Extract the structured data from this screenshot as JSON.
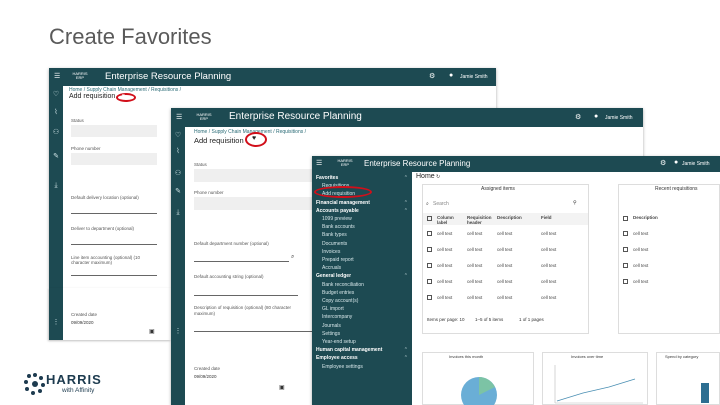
{
  "slide": {
    "title": "Create Favorites"
  },
  "app": {
    "name": "Enterprise Resource Planning",
    "user": "Jamie Smith",
    "logo_top": "HARRIS",
    "logo_bottom": "ERP"
  },
  "w1": {
    "breadcrumb": "Home / Supply Chain Management / Requisitions /",
    "page_title": "Add requisition",
    "fields": [
      "Status",
      "Phone number",
      "Default delivery location (optional)",
      "Deliver to department (optional)",
      "Line item accounting (optional) (10 character maximum)",
      "Created date",
      "Created date value"
    ],
    "created_value": "09/09/2020"
  },
  "w2": {
    "breadcrumb": "Home / Supply Chain Management / Requisitions /",
    "page_title": "Add requisition",
    "fields": [
      "Status",
      "Phone number",
      "Default department number (optional)",
      "Default accounting string (optional)",
      "Description of requisition (optional) (80 character maximum)",
      "Created date"
    ],
    "created_value": "09/09/2020"
  },
  "w3": {
    "home_title": "Home",
    "nav": [
      {
        "label": "Favorites",
        "type": "hd"
      },
      {
        "label": "Requisitions",
        "type": "sub"
      },
      {
        "label": "Add requisition",
        "type": "sub"
      },
      {
        "label": "Financial management",
        "type": "hd"
      },
      {
        "label": "Accounts payable",
        "type": "hd"
      },
      {
        "label": "1099 preview",
        "type": "sub"
      },
      {
        "label": "Bank accounts",
        "type": "sub"
      },
      {
        "label": "Bank types",
        "type": "sub"
      },
      {
        "label": "Documents",
        "type": "sub"
      },
      {
        "label": "Invoices",
        "type": "sub"
      },
      {
        "label": "Prepaid report",
        "type": "sub"
      },
      {
        "label": "Accruals",
        "type": "sub"
      },
      {
        "label": "General ledger",
        "type": "hd"
      },
      {
        "label": "Bank reconciliation",
        "type": "sub"
      },
      {
        "label": "Budget entries",
        "type": "sub"
      },
      {
        "label": "Copy account(s)",
        "type": "sub"
      },
      {
        "label": "GL import",
        "type": "sub"
      },
      {
        "label": "Intercompany",
        "type": "sub"
      },
      {
        "label": "Journals",
        "type": "sub"
      },
      {
        "label": "Settings",
        "type": "sub"
      },
      {
        "label": "Year-end setup",
        "type": "sub"
      },
      {
        "label": "Human capital management",
        "type": "hd"
      },
      {
        "label": "Employee access",
        "type": "hd"
      },
      {
        "label": "Employee settings",
        "type": "sub"
      }
    ],
    "panel1": {
      "title": "Assigned items",
      "search": "Search",
      "headers": [
        "Column label",
        "Requisition header",
        "Description",
        "Field"
      ],
      "rows": [
        [
          "cell text",
          "cell text",
          "cell text",
          "cell text"
        ],
        [
          "cell text",
          "cell text",
          "cell text",
          "cell text"
        ],
        [
          "cell text",
          "cell text",
          "cell text",
          "cell text"
        ],
        [
          "cell text",
          "cell text",
          "cell text",
          "cell text"
        ],
        [
          "cell text",
          "cell text",
          "cell text",
          "cell text"
        ]
      ],
      "footer": [
        "Items per page: 10",
        "1–5 of 5 items",
        "1 of 1 pages"
      ]
    },
    "panel2": {
      "title": "Recent requisitions",
      "header": "Description",
      "rows": [
        "cell text",
        "cell text",
        "cell text",
        "cell text"
      ]
    },
    "charts": [
      "Invoices this month",
      "Invoices over time",
      "Spend by category"
    ]
  },
  "brand": {
    "name": "HARRIS",
    "sub": "with Affinity"
  },
  "colors": {
    "primary": "#1d4a52",
    "highlight": "#d10f1a"
  }
}
